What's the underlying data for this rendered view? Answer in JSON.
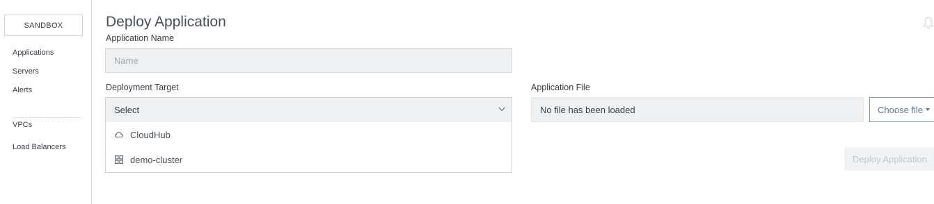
{
  "sidebar": {
    "environment_label": "SANDBOX",
    "items": [
      {
        "label": "Applications"
      },
      {
        "label": "Servers"
      },
      {
        "label": "Alerts"
      },
      {
        "label": "VPCs"
      },
      {
        "label": "Load Balancers"
      }
    ]
  },
  "header": {
    "title": "Deploy Application",
    "notification_icon": "bell-icon"
  },
  "form": {
    "app_name": {
      "label": "Application Name",
      "value": "",
      "placeholder": "Name"
    },
    "deployment_target": {
      "label": "Deployment Target",
      "selected": "Select",
      "options": [
        {
          "label": "CloudHub",
          "icon": "cloud-icon"
        },
        {
          "label": "demo-cluster",
          "icon": "cluster-icon"
        }
      ]
    },
    "app_file": {
      "label": "Application File",
      "status": "No file has been loaded",
      "choose_label": "Choose file"
    },
    "deploy_label": "Deploy Application"
  },
  "colors": {
    "accent": "#5b7a94",
    "input_bg": "#eef0f2",
    "disabled_text": "#c3c8cd"
  }
}
